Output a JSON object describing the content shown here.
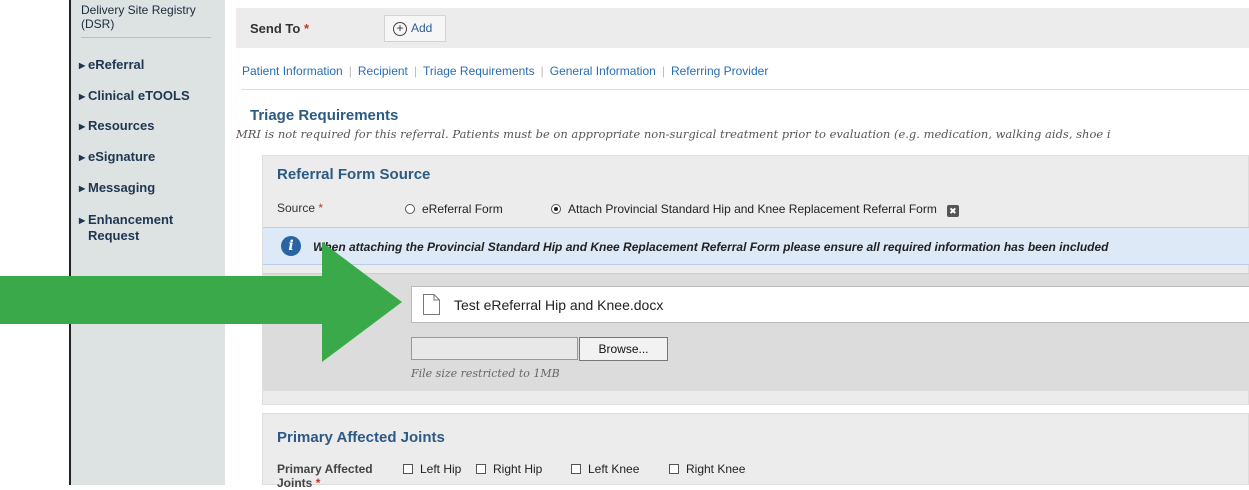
{
  "sidebar": {
    "top_item": "Delivery Site Registry (DSR)",
    "items": [
      {
        "label": "eReferral"
      },
      {
        "label": "Clinical eTOOLS"
      },
      {
        "label": "Resources"
      },
      {
        "label": "eSignature"
      },
      {
        "label": "Messaging"
      },
      {
        "label": "Enhancement",
        "label2": "Request"
      }
    ]
  },
  "send_to": {
    "label": "Send To",
    "required_mark": "*",
    "add_label": "Add"
  },
  "tabs": [
    "Patient Information",
    "Recipient",
    "Triage Requirements",
    "General Information",
    "Referring Provider"
  ],
  "triage": {
    "title": "Triage Requirements",
    "note": "MRI is not required for this referral. Patients must be on appropriate non-surgical treatment prior to evaluation (e.g. medication, walking aids, shoe i"
  },
  "referral_form_source": {
    "title": "Referral Form Source",
    "source_label": "Source",
    "required_mark": "*",
    "options": [
      {
        "label": "eReferral Form",
        "selected": false
      },
      {
        "label": "Attach Provincial Standard Hip and Knee Replacement Referral Form",
        "selected": true
      }
    ],
    "info_text": "When attaching the Provincial Standard Hip and Knee Replacement Referral Form please ensure all required information has been included",
    "file_name": "Test eReferral Hip and Knee.docx",
    "browse_label": "Browse...",
    "size_note": "File size restricted to 1MB"
  },
  "primary_joints": {
    "title": "Primary Affected Joints",
    "label": "Primary Affected Joints",
    "required_mark": "*",
    "options": [
      "Left Hip",
      "Right Hip",
      "Left Knee",
      "Right Knee"
    ]
  },
  "colors": {
    "arrow": "#3aa94a",
    "heading": "#2b5a85",
    "link": "#2a6db0",
    "info_bg": "#dde9f7"
  }
}
